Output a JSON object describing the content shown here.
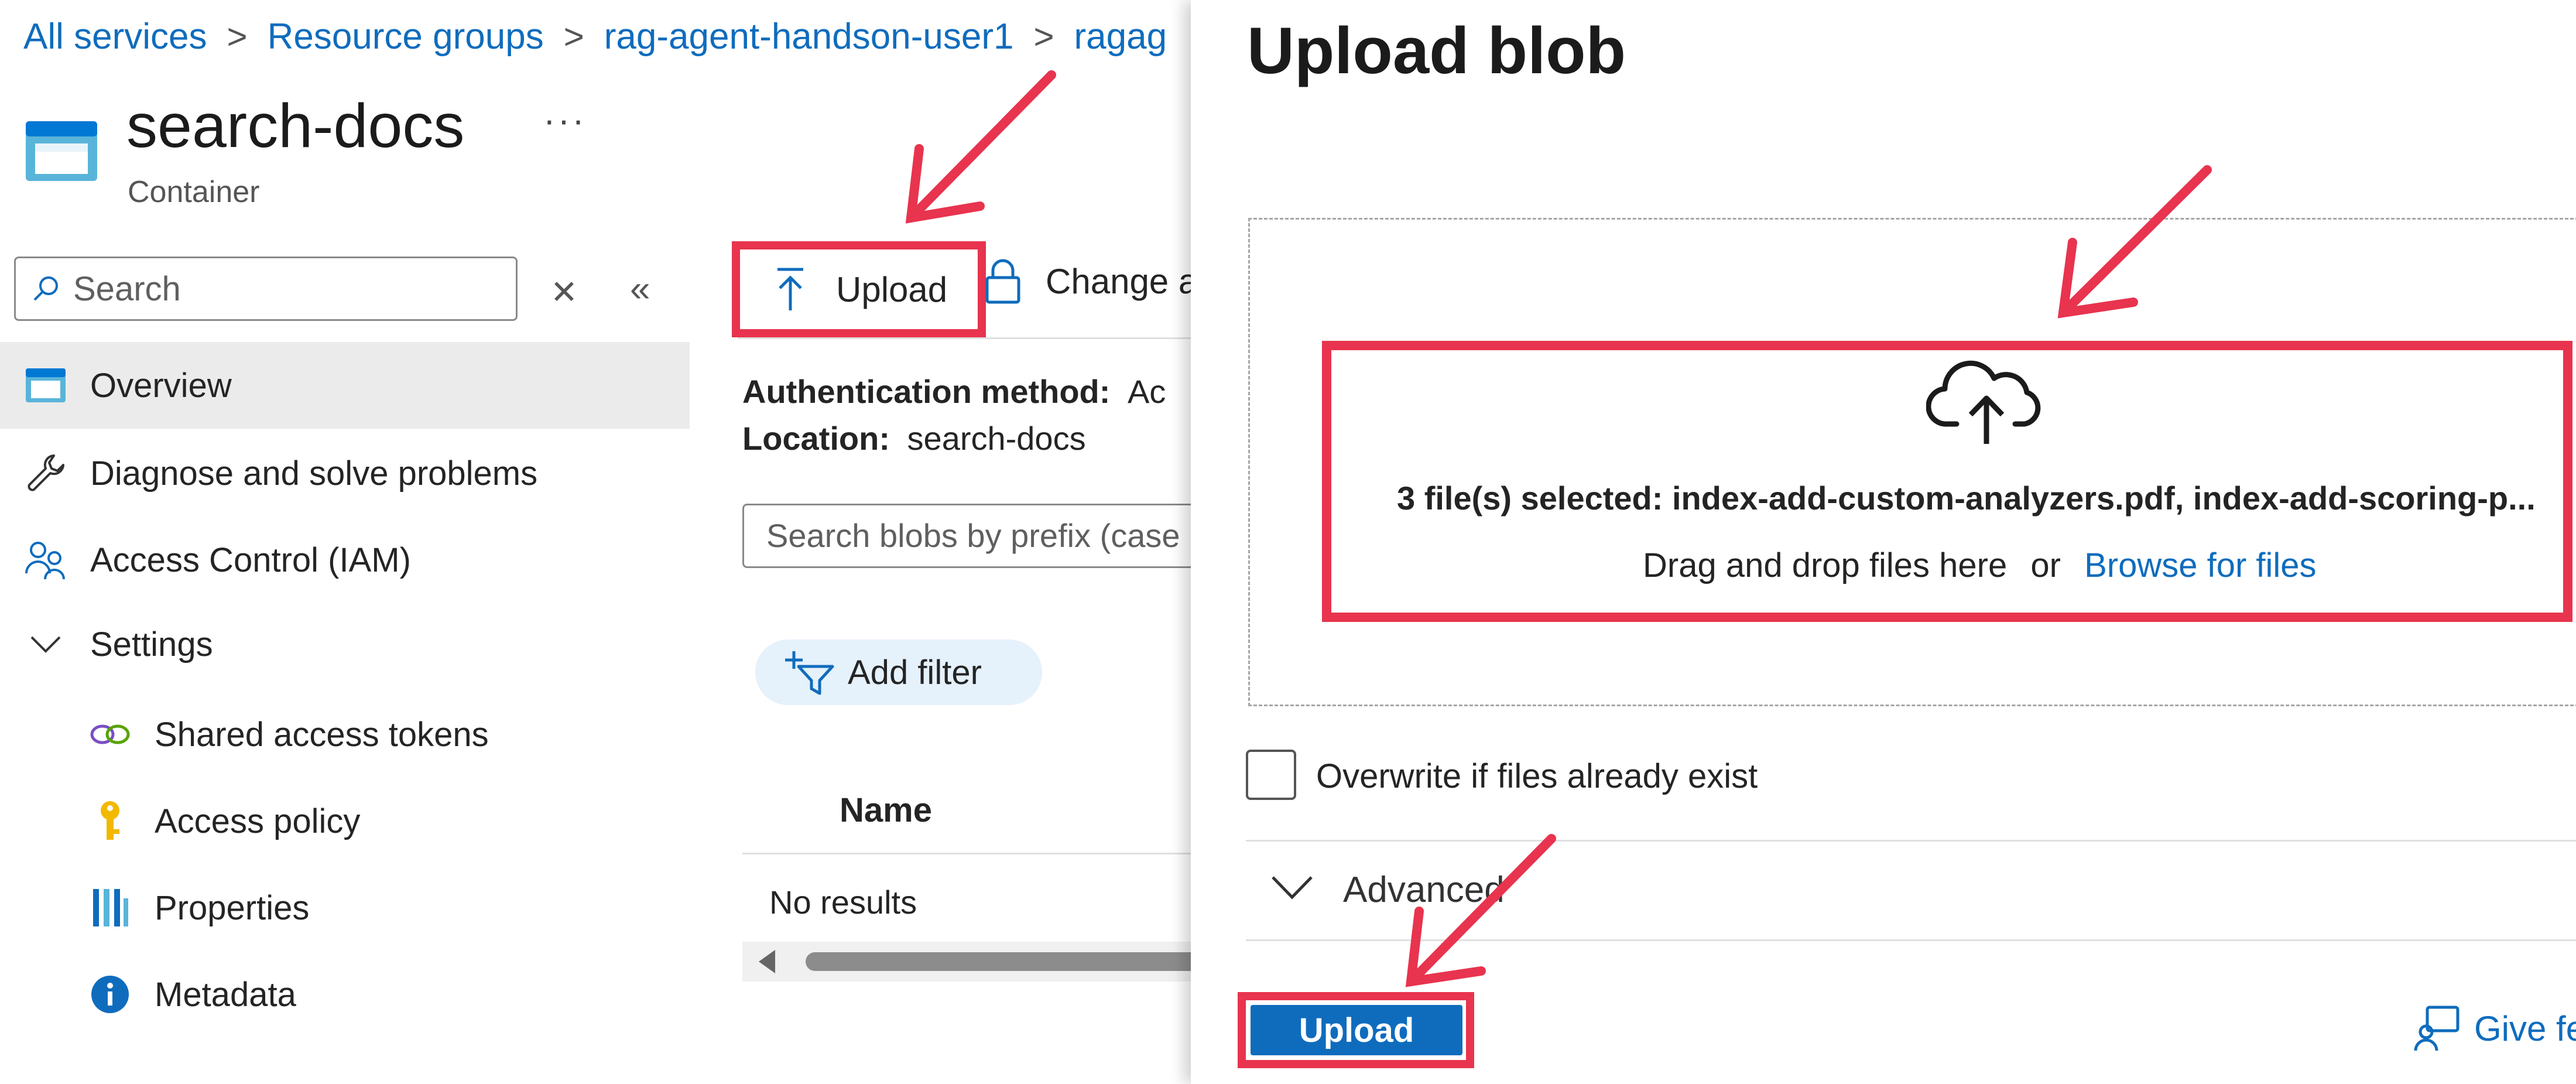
{
  "breadcrumb": {
    "items": [
      "All services",
      "Resource groups",
      "rag-agent-handson-user1",
      "ragag"
    ],
    "separator": ">"
  },
  "resource": {
    "title": "search-docs",
    "subtitle": "Container",
    "more_label": "···"
  },
  "sidebar": {
    "search_placeholder": "Search",
    "items": [
      {
        "label": "Overview",
        "icon": "container-icon"
      },
      {
        "label": "Diagnose and solve problems",
        "icon": "wrench-icon"
      },
      {
        "label": "Access Control (IAM)",
        "icon": "people-icon"
      },
      {
        "label": "Settings",
        "icon": "chevron-down-icon"
      },
      {
        "label": "Shared access tokens",
        "icon": "link-icon"
      },
      {
        "label": "Access policy",
        "icon": "key-icon"
      },
      {
        "label": "Properties",
        "icon": "bars-icon"
      },
      {
        "label": "Metadata",
        "icon": "info-icon"
      }
    ]
  },
  "toolbar": {
    "upload_label": "Upload",
    "change_access_label": "Change a"
  },
  "details": {
    "auth_label": "Authentication method:",
    "auth_value": "Ac",
    "location_label": "Location:",
    "location_value": "search-docs",
    "blob_search_placeholder": "Search blobs by prefix (case",
    "add_filter_label": "Add filter",
    "column_name": "Name",
    "empty_text": "No results"
  },
  "upload_panel": {
    "title": "Upload blob",
    "selected_text": "3 file(s) selected: index-add-custom-analyzers.pdf, index-add-scoring-p...",
    "drag_text": "Drag and drop files here",
    "or_text": "or",
    "browse_label": "Browse for files",
    "overwrite_label": "Overwrite if files already exist",
    "overwrite_checked": false,
    "advanced_label": "Advanced",
    "upload_button": "Upload",
    "feedback_label": "Give fe"
  },
  "colors": {
    "accent": "#0f6cbd",
    "annotation": "#e8344e",
    "selected_bg": "#ebebeb"
  }
}
